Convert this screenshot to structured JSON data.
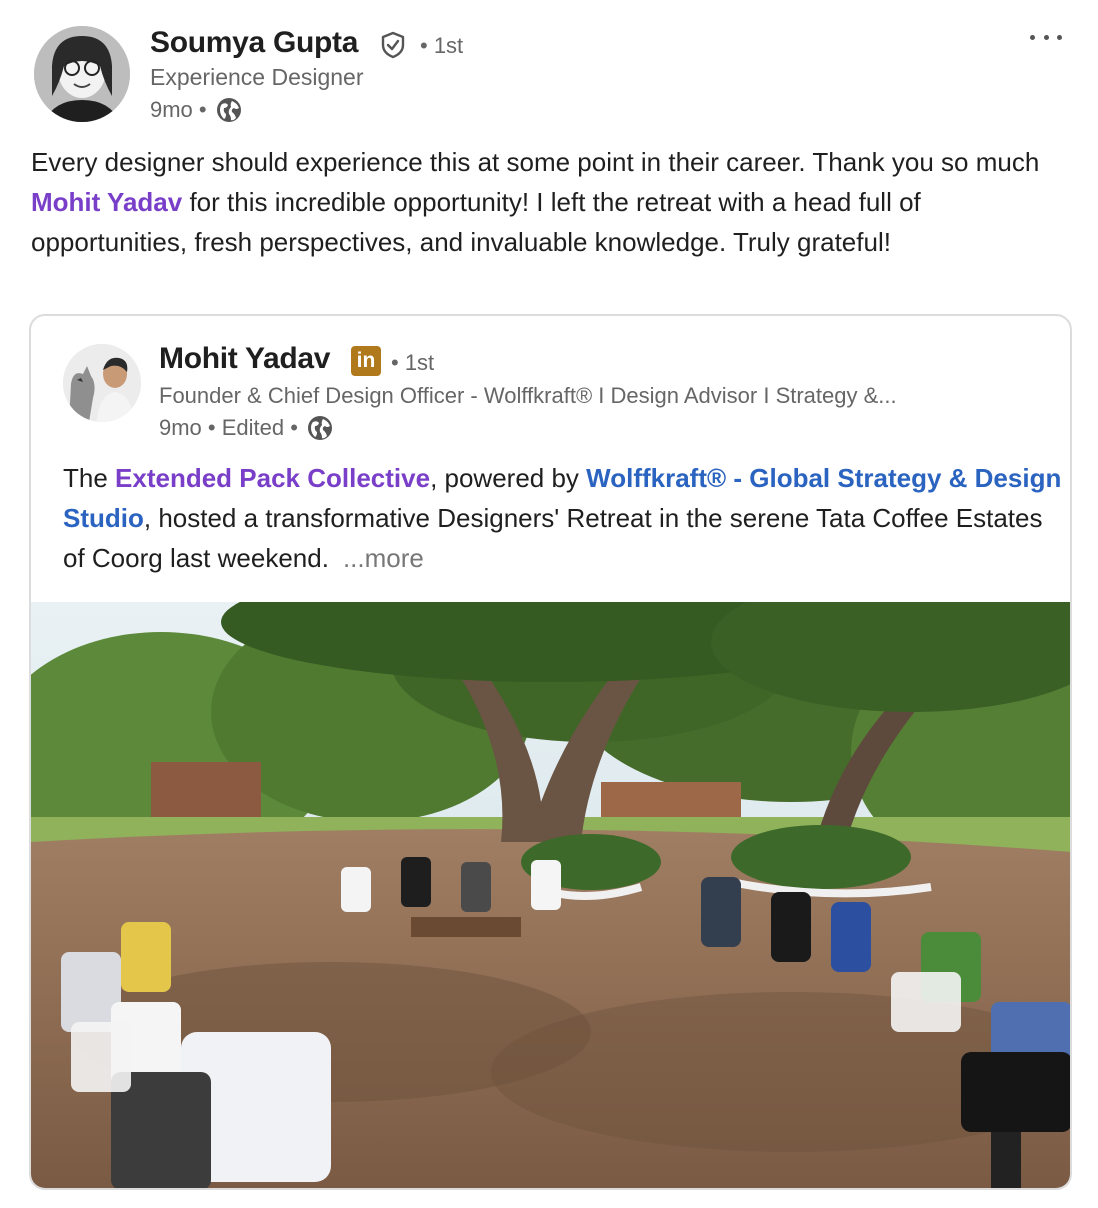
{
  "author": {
    "name": "Soumya Gupta",
    "degree": "• 1st",
    "headline": "Experience Designer",
    "time": "9mo •"
  },
  "post": {
    "text_before": "Every designer should experience this at some point in their career. Thank you so much ",
    "mention": "Mohit Yadav",
    "text_after": " for this incredible opportunity! I left the retreat with a head full of opportunities, fresh perspectives, and invaluable knowledge. Truly grateful!"
  },
  "reshare": {
    "name": "Mohit Yadav",
    "badge": "in",
    "degree": "• 1st",
    "headline": "Founder & Chief Design Officer - Wolffkraft® I Design Advisor I Strategy &...",
    "time": "9mo • Edited •",
    "text_1": "The ",
    "link_1": "Extended Pack Collective",
    "text_2": ", powered by ",
    "link_2": "Wolffkraft® - Global Strategy & Design Studio",
    "text_3": ", hosted a transformative Designers' Retreat in the serene Tata Coffee Estates of Coorg last weekend.",
    "more": "...more"
  },
  "icons": {
    "verified": "shield-check-icon",
    "globe": "globe-icon",
    "menu": "more-horizontal-icon"
  },
  "colors": {
    "mention_purple": "#7a3fc9",
    "link_blue": "#2a63c0",
    "linkedin_badge": "#b07a1c"
  }
}
